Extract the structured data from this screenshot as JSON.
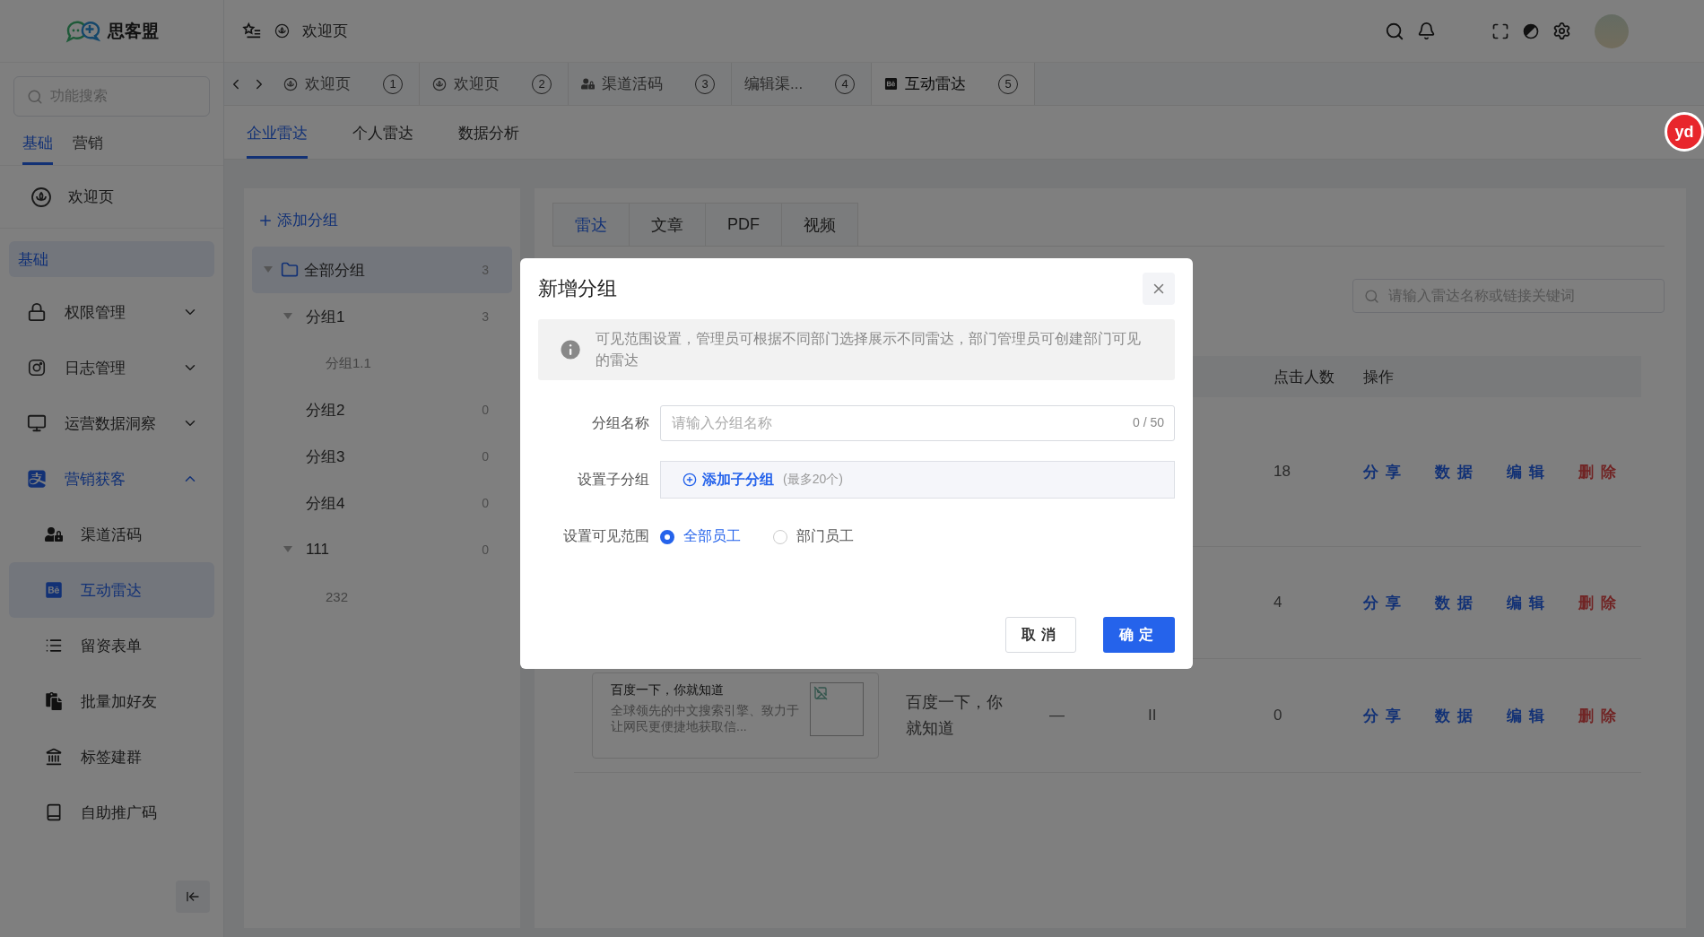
{
  "app": {
    "logo_text": "思客盟"
  },
  "header": {
    "breadcrumb": "欢迎页"
  },
  "sidebar": {
    "search_placeholder": "功能搜索",
    "tabs": [
      {
        "label": "基础",
        "selected": true
      },
      {
        "label": "营销",
        "selected": false
      }
    ],
    "pinned": {
      "label": "欢迎页"
    },
    "section_label": "基础",
    "items": [
      {
        "label": "权限管理",
        "expanded": false,
        "active": false
      },
      {
        "label": "日志管理",
        "expanded": false,
        "active": false
      },
      {
        "label": "运营数据洞察",
        "expanded": false,
        "active": false
      },
      {
        "label": "营销获客",
        "expanded": true,
        "active": true,
        "children": [
          {
            "label": "渠道活码",
            "selected": false
          },
          {
            "label": "互动雷达",
            "selected": true
          },
          {
            "label": "留资表单",
            "selected": false
          },
          {
            "label": "批量加好友",
            "selected": false
          },
          {
            "label": "标签建群",
            "selected": false
          },
          {
            "label": "自助推广码",
            "selected": false
          }
        ]
      }
    ]
  },
  "page_tabs": [
    {
      "label": "欢迎页",
      "number": "1",
      "selected": false
    },
    {
      "label": "欢迎页",
      "number": "2",
      "selected": false
    },
    {
      "label": "渠道活码",
      "number": "3",
      "selected": false
    },
    {
      "label": "编辑渠...",
      "number": "4",
      "selected": false
    },
    {
      "label": "互动雷达",
      "number": "5",
      "selected": true
    }
  ],
  "sub_tabs": [
    {
      "label": "企业雷达",
      "selected": true
    },
    {
      "label": "个人雷达",
      "selected": false
    },
    {
      "label": "数据分析",
      "selected": false
    }
  ],
  "groups_panel": {
    "add_button": "添加分组",
    "tree": [
      {
        "label": "全部分组",
        "count": "3",
        "selected": true,
        "expanded": true,
        "children": [
          {
            "label": "分组1",
            "count": "3",
            "selected": false,
            "expanded": true,
            "children": [
              {
                "label": "分组1.1",
                "selected": false
              }
            ]
          },
          {
            "label": "分组2",
            "count": "0",
            "selected": false
          },
          {
            "label": "分组3",
            "count": "0",
            "selected": false
          },
          {
            "label": "分组4",
            "count": "0",
            "selected": false
          },
          {
            "label": "111",
            "count": "0",
            "selected": false,
            "expanded": true,
            "children": [
              {
                "label": "232",
                "selected": false
              }
            ]
          }
        ]
      }
    ]
  },
  "content": {
    "type_tabs": [
      {
        "label": "雷达",
        "selected": true
      },
      {
        "label": "文章",
        "selected": false
      },
      {
        "label": "PDF",
        "selected": false
      },
      {
        "label": "视频",
        "selected": false
      }
    ],
    "search_placeholder": "请输入雷达名称或链接关键词",
    "table": {
      "columns": [
        {
          "label": "点击人数"
        },
        {
          "label": "操作"
        }
      ],
      "rows": [
        {
          "clicks": "18",
          "actions": [
            {
              "label": "分享",
              "kind": "primary"
            },
            {
              "label": "数据",
              "kind": "primary"
            },
            {
              "label": "编辑",
              "kind": "primary"
            },
            {
              "label": "删除",
              "kind": "danger"
            }
          ]
        },
        {
          "clicks": "4",
          "actions": [
            {
              "label": "分享",
              "kind": "primary"
            },
            {
              "label": "数据",
              "kind": "primary"
            },
            {
              "label": "编辑",
              "kind": "primary"
            },
            {
              "label": "删除",
              "kind": "danger"
            }
          ]
        },
        {
          "card": {
            "title": "百度一下，你就知道",
            "description": "全球领先的中文搜索引擎、致力于让网民更便捷地获取信..."
          },
          "name": "百度一下，你就知道",
          "column_3": "—",
          "column_4": "II",
          "clicks": "0",
          "actions": [
            {
              "label": "分享",
              "kind": "primary"
            },
            {
              "label": "数据",
              "kind": "primary"
            },
            {
              "label": "编辑",
              "kind": "primary"
            },
            {
              "label": "删除",
              "kind": "danger"
            }
          ]
        }
      ]
    }
  },
  "modal": {
    "title": "新增分组",
    "notice": "可见范围设置，管理员可根据不同部门选择展示不同雷达，部门管理员可创建部门可见的雷达",
    "fields": [
      {
        "label": "分组名称",
        "kind": "text",
        "placeholder": "请输入分组名称",
        "counter": "0 / 50"
      },
      {
        "label": "设置子分组",
        "kind": "add",
        "button": "添加子分组",
        "hint": "(最多20个)"
      },
      {
        "label": "设置可见范围",
        "kind": "radio",
        "options": [
          {
            "label": "全部员工",
            "selected": true
          },
          {
            "label": "部门员工",
            "selected": false
          }
        ]
      }
    ],
    "buttons": [
      {
        "label": "取消",
        "kind": "default"
      },
      {
        "label": "确定",
        "kind": "primary"
      }
    ]
  },
  "floating_badge": "yd"
}
